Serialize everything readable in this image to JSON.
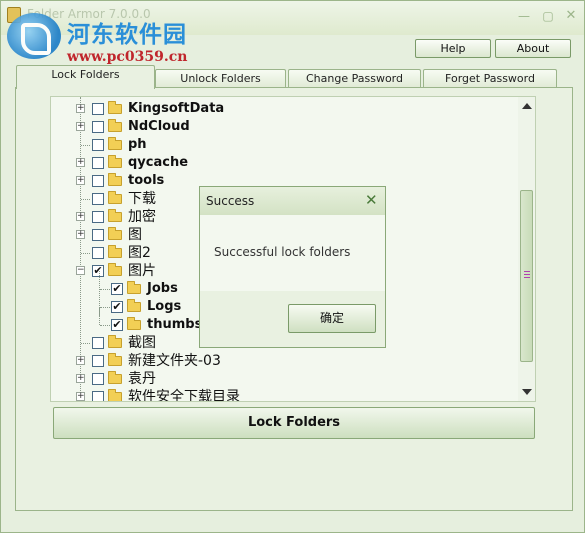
{
  "window": {
    "title": "Folder Armor 7.0.0.0"
  },
  "watermark": {
    "site_name": "河东软件园",
    "url": "www.pc0359.cn"
  },
  "header_buttons": {
    "help": "Help",
    "about": "About"
  },
  "tabs": [
    {
      "label": "Lock Folders",
      "active": true
    },
    {
      "label": "Unlock Folders",
      "active": false
    },
    {
      "label": "Change Password",
      "active": false
    },
    {
      "label": "Forget Password",
      "active": false
    }
  ],
  "tree": {
    "items": [
      {
        "label": "KingsoftData",
        "checked": false,
        "expandable": true,
        "level": 0
      },
      {
        "label": "NdCloud",
        "checked": false,
        "expandable": true,
        "level": 0
      },
      {
        "label": "ph",
        "checked": false,
        "expandable": false,
        "level": 0
      },
      {
        "label": "qycache",
        "checked": false,
        "expandable": true,
        "level": 0
      },
      {
        "label": "tools",
        "checked": false,
        "expandable": true,
        "level": 0
      },
      {
        "label": "下载",
        "checked": false,
        "expandable": false,
        "level": 0
      },
      {
        "label": "加密",
        "checked": false,
        "expandable": true,
        "level": 0
      },
      {
        "label": "图",
        "checked": false,
        "expandable": true,
        "level": 0
      },
      {
        "label": "图2",
        "checked": false,
        "expandable": false,
        "level": 0
      },
      {
        "label": "图片",
        "checked": true,
        "expandable": true,
        "expanded": true,
        "level": 0
      },
      {
        "label": "Jobs",
        "checked": true,
        "expandable": false,
        "level": 1
      },
      {
        "label": "Logs",
        "checked": true,
        "expandable": false,
        "level": 1
      },
      {
        "label": "thumbs",
        "checked": true,
        "expandable": false,
        "level": 1
      },
      {
        "label": "截图",
        "checked": false,
        "expandable": false,
        "level": 0
      },
      {
        "label": "新建文件夹-03",
        "checked": false,
        "expandable": true,
        "level": 0
      },
      {
        "label": "袁丹",
        "checked": false,
        "expandable": true,
        "level": 0
      },
      {
        "label": "软件安全下载目录",
        "checked": false,
        "expandable": true,
        "level": 0
      }
    ]
  },
  "lock_button": "Lock Folders",
  "dialog": {
    "title": "Success",
    "message": "Successful lock folders",
    "ok_label": "确定"
  },
  "colors": {
    "accent_green": "#9bb48a",
    "scroll_grip": "#b23fb0"
  }
}
